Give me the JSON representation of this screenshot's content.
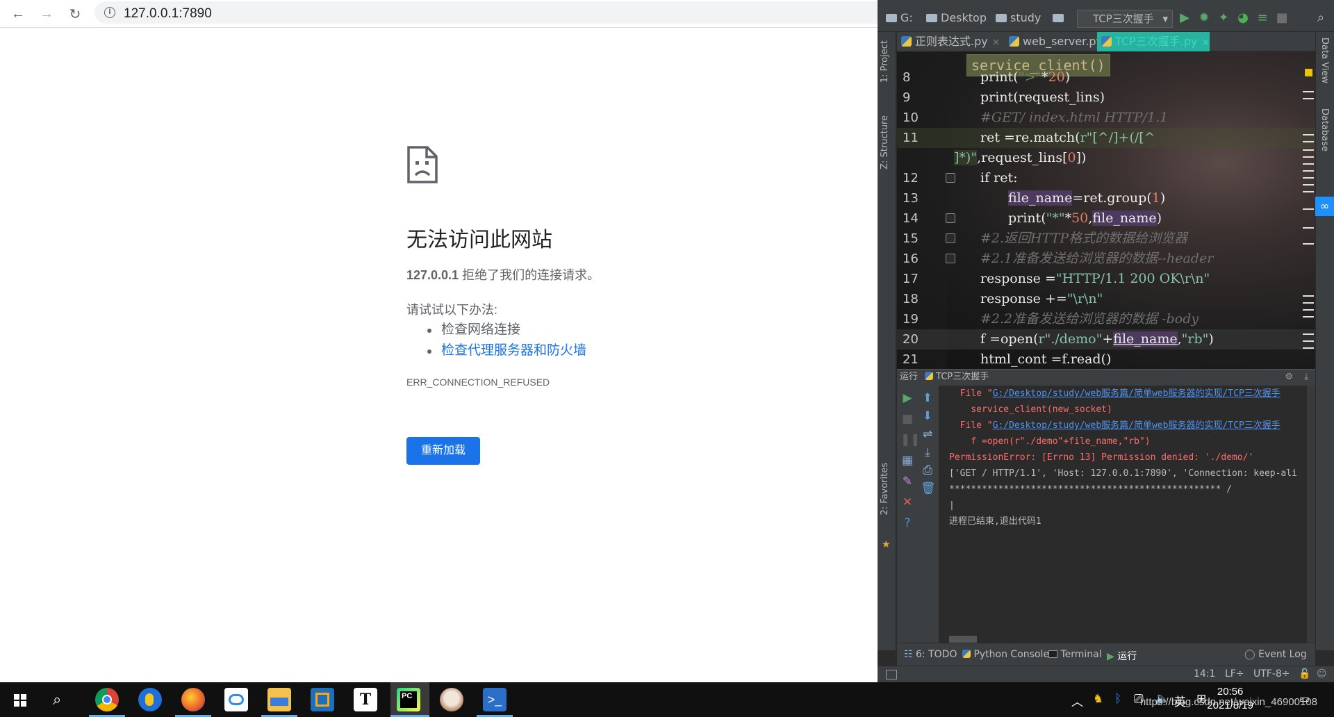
{
  "browser": {
    "url": "127.0.0.1:7890",
    "error": {
      "title": "无法访问此网站",
      "host": "127.0.0.1",
      "message": "拒绝了我们的连接请求。",
      "try_heading": "请试试以下办法:",
      "suggestions": [
        "检查网络连接",
        "检查代理服务器和防火墙"
      ],
      "code": "ERR_CONNECTION_REFUSED",
      "reload_label": "重新加载"
    }
  },
  "ide": {
    "breadcrumbs": [
      "G:",
      "Desktop",
      "study"
    ],
    "run_config": "TCP三次握手",
    "left_tools": [
      "1: Project",
      "Z: Structure",
      "2: Favorites"
    ],
    "right_tools": [
      "Data View",
      "Database"
    ],
    "tabs": [
      "正则表达式.py",
      "web_server.py",
      "TCP三次握手.py"
    ],
    "function_breadcrumb": "service_client()",
    "code_lines": [
      {
        "num": "8",
        "text": "print(\">\"*20)"
      },
      {
        "num": "9",
        "text": "print(request_lins)"
      },
      {
        "num": "10",
        "text": "#GET/ index.html HTTP/1.1"
      },
      {
        "num": "11",
        "text": "ret =re.match(r\"[^/]+(/[^"
      },
      {
        "num": "",
        "text": "]*)\",request_lins[0])"
      },
      {
        "num": "12",
        "text": "if ret:"
      },
      {
        "num": "13",
        "text": "file_name=ret.group(1)"
      },
      {
        "num": "14",
        "text": "print(\"*\"*50,file_name)"
      },
      {
        "num": "15",
        "text": "#2.返回HTTP格式的数据给浏览器"
      },
      {
        "num": "16",
        "text": "#2.1准备发送给浏览器的数据--header"
      },
      {
        "num": "17",
        "text": "response =\"HTTP/1.1 200 OK\\r\\n\""
      },
      {
        "num": "18",
        "text": "response +=\"\\r\\n\""
      },
      {
        "num": "19",
        "text": "#2.2准备发送给浏览器的数据 -body"
      },
      {
        "num": "20",
        "text": "f =open(r\"./demo\"+file_name,\"rb\")"
      },
      {
        "num": "21",
        "text": "html_cont =f.read()"
      }
    ],
    "run_panel": {
      "label": "运行",
      "config": "TCP三次握手",
      "console": [
        {
          "prefix": "  File \"",
          "link": "G:/Desktop/study/web服务篇/简单web服务器的实现/TCP三次握手",
          "type": "trace"
        },
        {
          "text": "    service_client(new_socket)",
          "type": "normal"
        },
        {
          "prefix": "  File \"",
          "link": "G:/Desktop/study/web服务篇/简单web服务器的实现/TCP三次握手",
          "type": "trace"
        },
        {
          "text": "    f =open(r\"./demo\"+file_name,\"rb\")",
          "type": "normal"
        },
        {
          "text": "PermissionError: [Errno 13] Permission denied: './demo/'",
          "type": "error"
        },
        {
          "text": "['GET / HTTP/1.1', 'Host: 127.0.0.1:7890', 'Connection: keep-ali",
          "type": "normal"
        },
        {
          "text": "************************************************** /",
          "type": "normal"
        },
        {
          "text": "|",
          "type": "normal"
        },
        {
          "text": "进程已结束,退出代码1",
          "type": "normal"
        }
      ]
    },
    "bottom_tools": [
      "6: TODO",
      "Python Console",
      "Terminal",
      "运行",
      "Event Log"
    ],
    "status": {
      "position": "14:1",
      "line_sep": "LF÷",
      "encoding": "UTF-8÷"
    }
  },
  "taskbar": {
    "tray_lang": "英",
    "time": "20:56",
    "date": "2021/8/19",
    "watermark": "https://blog.csdn.net/weixin_46900108"
  }
}
